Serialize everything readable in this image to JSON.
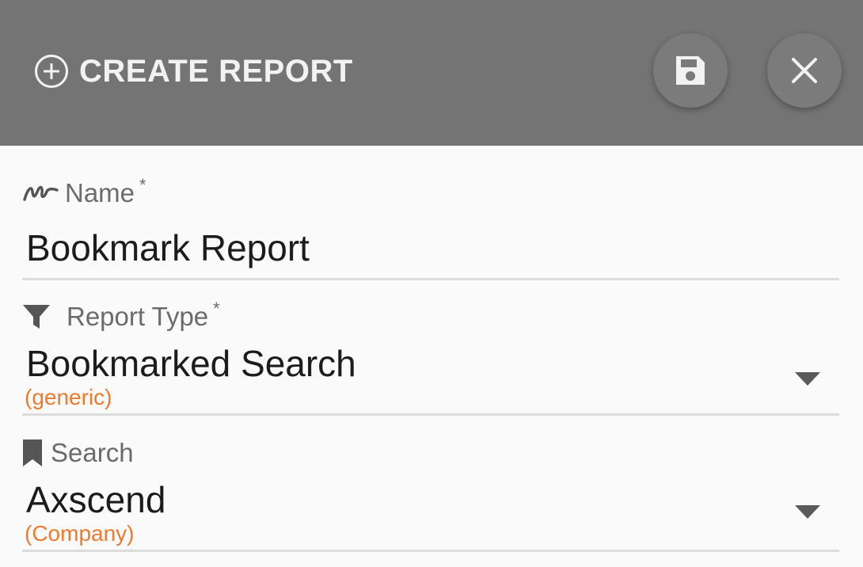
{
  "header": {
    "title": "CREATE REPORT",
    "title_icon": "add-circle-icon",
    "save_icon": "save-icon",
    "close_icon": "close-icon"
  },
  "form": {
    "name": {
      "label": "Name",
      "required_mark": "*",
      "icon": "signature-icon",
      "value": "Bookmark Report"
    },
    "report_type": {
      "label": "Report Type",
      "required_mark": "*",
      "icon": "filter-icon",
      "value": "Bookmarked Search",
      "sub": "(generic)"
    },
    "search": {
      "label": "Search",
      "icon": "bookmark-icon",
      "value": "Axscend",
      "sub": "(Company)"
    }
  },
  "colors": {
    "header_bg": "#747474",
    "header_text": "#f2f2f2",
    "accent_sub": "#ef7a2e",
    "body_bg": "#fafafa"
  }
}
